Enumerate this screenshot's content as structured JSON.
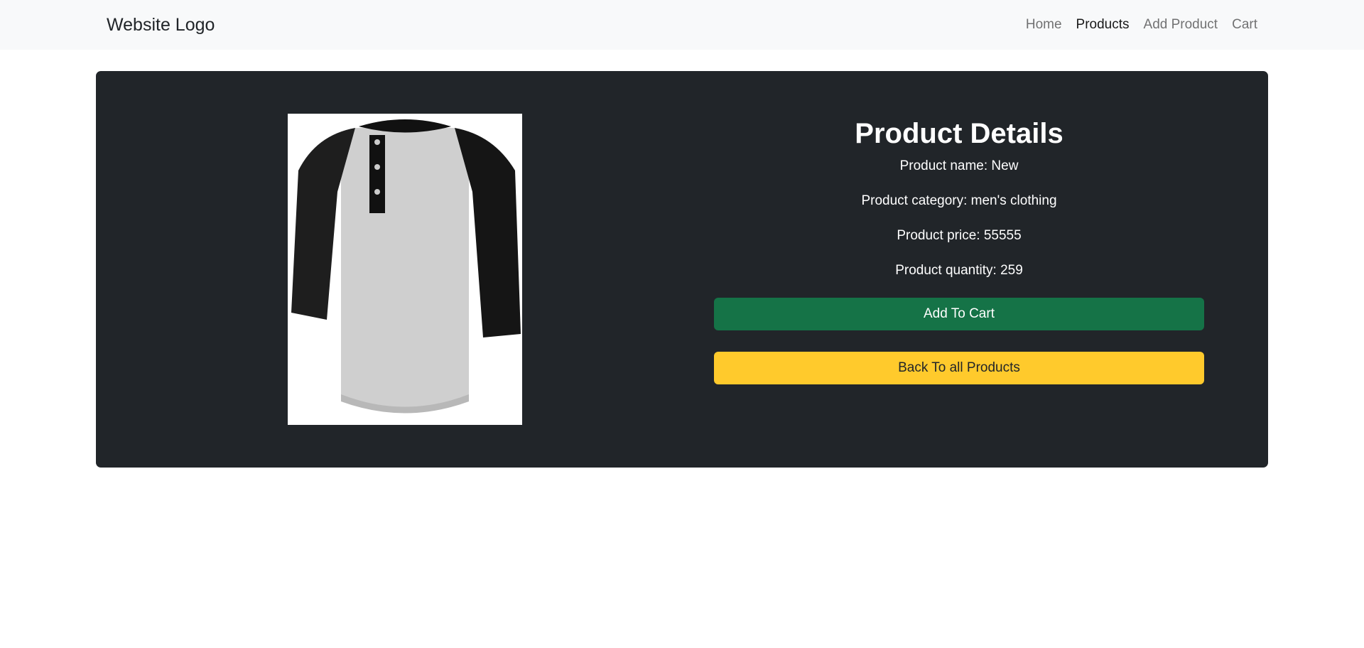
{
  "navbar": {
    "brand": "Website Logo",
    "links": [
      "Home",
      "Products",
      "Add Product",
      "Cart"
    ],
    "active": "Products"
  },
  "product": {
    "heading": "Product Details",
    "name": "Product name: New",
    "category": "Product category: men's clothing",
    "price": "Product price: 55555",
    "quantity": "Product quantity: 259",
    "image_alt": "henley-raglan-shirt"
  },
  "buttons": {
    "add_to_cart": "Add To Cart",
    "back": "Back To all Products"
  },
  "colors": {
    "card_bg": "#212529",
    "success": "#157347",
    "warning": "#ffca2c",
    "navbar_bg": "#f8f9fa"
  }
}
